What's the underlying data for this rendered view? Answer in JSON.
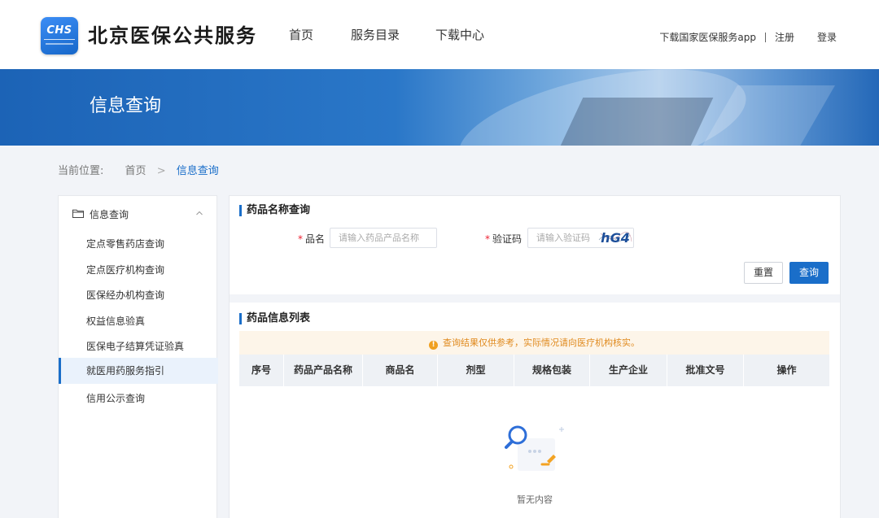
{
  "header": {
    "logo_text": "CHS",
    "site_title": "北京医保公共服务",
    "nav": [
      {
        "label": "首页"
      },
      {
        "label": "服务目录"
      },
      {
        "label": "下载中心"
      }
    ],
    "download_app": "下载国家医保服务app",
    "register": "注册",
    "login": "登录"
  },
  "banner": {
    "title": "信息查询"
  },
  "breadcrumb": {
    "label": "当前位置:",
    "home": "首页",
    "arrow": ">",
    "current": "信息查询"
  },
  "sidebar": {
    "group_label": "信息查询",
    "items": [
      {
        "label": "定点零售药店查询"
      },
      {
        "label": "定点医疗机构查询"
      },
      {
        "label": "医保经办机构查询"
      },
      {
        "label": "权益信息验真"
      },
      {
        "label": "医保电子结算凭证验真"
      },
      {
        "label": "就医用药服务指引"
      },
      {
        "label": "信用公示查询"
      }
    ],
    "active_index": 5
  },
  "search": {
    "title": "药品名称查询",
    "name_label": "品名",
    "name_placeholder": "请输入药品产品名称",
    "name_value": "",
    "captcha_label": "验证码",
    "captcha_placeholder": "请输入验证码",
    "captcha_value": "",
    "captcha_text": "hG4",
    "reset_label": "重置",
    "query_label": "查询"
  },
  "list": {
    "title": "药品信息列表",
    "notice": "查询结果仅供参考，实际情况请向医疗机构核实。",
    "columns": [
      "序号",
      "药品产品名称",
      "商品名",
      "剂型",
      "规格包装",
      "生产企业",
      "批准文号",
      "操作"
    ],
    "rows": [],
    "empty_text": "暂无内容"
  },
  "colors": {
    "primary": "#1a6ec9",
    "banner": "#1c63b6",
    "notice_bg": "#fdf5e9",
    "notice_text": "#e08a1e",
    "required": "#ee2233"
  }
}
